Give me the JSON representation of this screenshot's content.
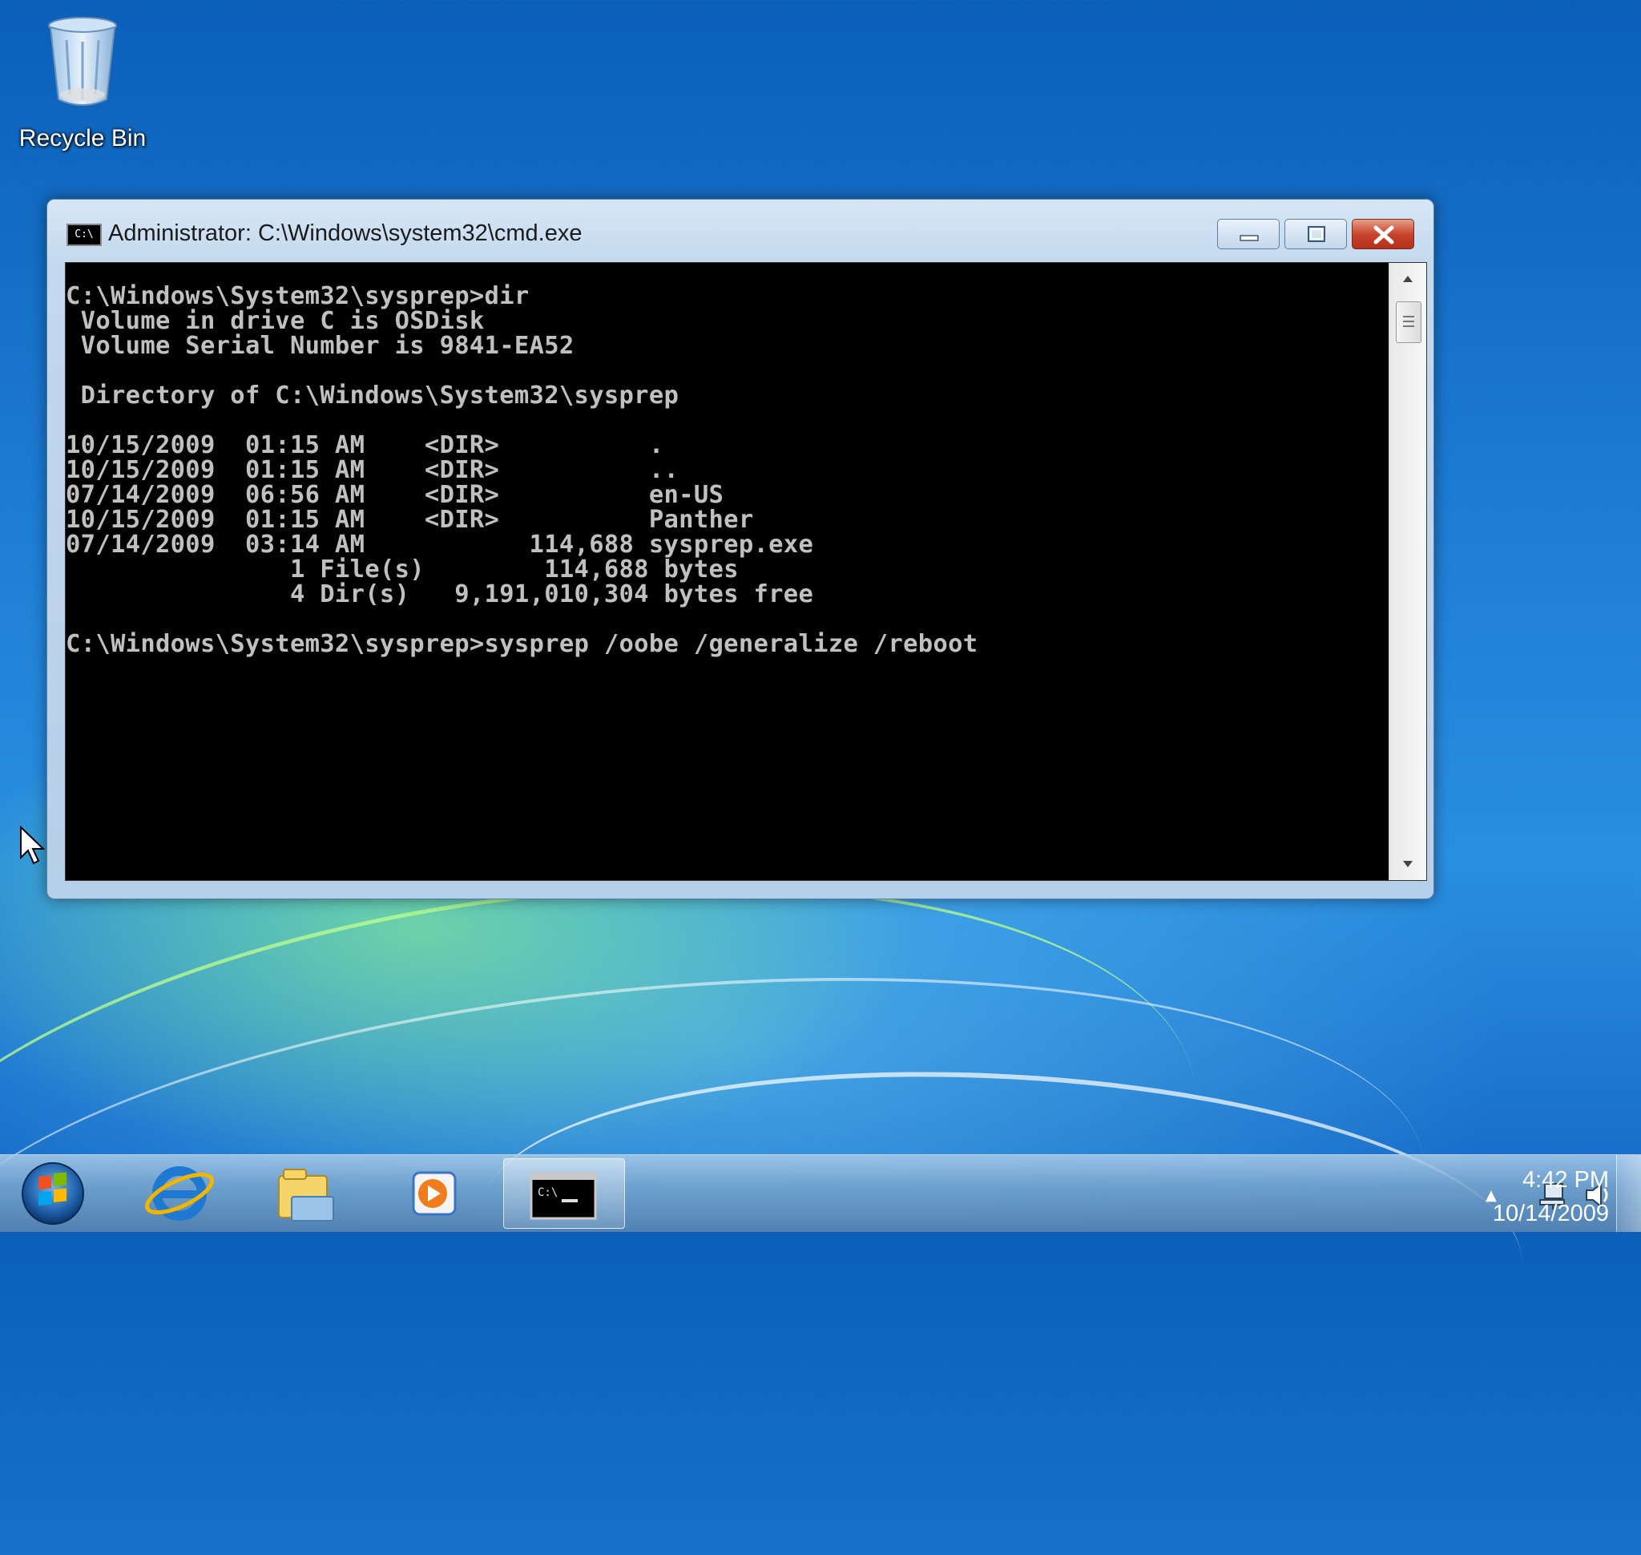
{
  "desktop": {
    "icons": [
      {
        "label": "Recycle Bin",
        "icon": "recycle-bin-icon"
      }
    ]
  },
  "window": {
    "title": "Administrator: C:\\Windows\\system32\\cmd.exe",
    "icon": "cmd-icon",
    "controls": {
      "minimize": "minimize-icon",
      "maximize": "maximize-icon",
      "close": "close-icon"
    },
    "console_lines": [
      "C:\\Windows\\System32\\sysprep>dir",
      " Volume in drive C is OSDisk",
      " Volume Serial Number is 9841-EA52",
      "",
      " Directory of C:\\Windows\\System32\\sysprep",
      "",
      "10/15/2009  01:15 AM    <DIR>          .",
      "10/15/2009  01:15 AM    <DIR>          ..",
      "07/14/2009  06:56 AM    <DIR>          en-US",
      "10/15/2009  01:15 AM    <DIR>          Panther",
      "07/14/2009  03:14 AM           114,688 sysprep.exe",
      "               1 File(s)        114,688 bytes",
      "               4 Dir(s)   9,191,010,304 bytes free",
      "",
      "C:\\Windows\\System32\\sysprep>sysprep /oobe /generalize /reboot"
    ]
  },
  "taskbar": {
    "start": "windows-start-icon",
    "pinned": [
      "internet-explorer-icon",
      "windows-explorer-icon",
      "windows-media-player-icon",
      "cmd-icon"
    ],
    "tray": {
      "icons": [
        "show-hidden-icons-icon",
        "network-icon",
        "volume-icon"
      ]
    },
    "clock": {
      "time": "4:42 PM",
      "date": "10/14/2009"
    }
  },
  "colors": {
    "console_bg": "#000000",
    "console_text": "#c0c0c0",
    "close_red": "#c9442c"
  }
}
